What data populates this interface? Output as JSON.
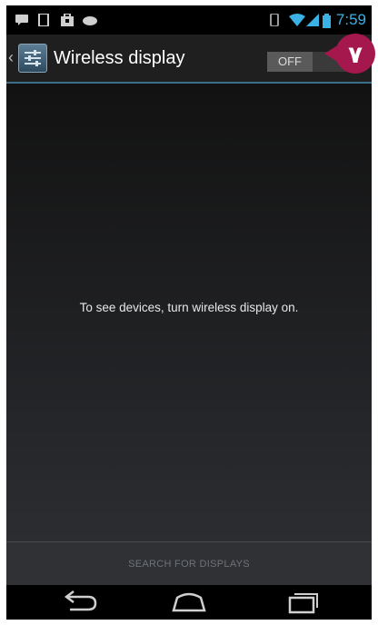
{
  "status_bar": {
    "time": "7:59",
    "notification_icons": [
      "message-icon",
      "sim-icon",
      "bag-icon",
      "controller-icon"
    ],
    "system_icons": [
      "vibrate-icon",
      "wifi-icon",
      "signal-icon",
      "battery-icon"
    ]
  },
  "action_bar": {
    "title": "Wireless display",
    "toggle_label": "OFF",
    "toggle_state": "off",
    "callout_label": "٧"
  },
  "content": {
    "empty_message": "To see devices, turn wireless display on."
  },
  "bottom_action": {
    "label": "SEARCH FOR DISPLAYS",
    "enabled": false
  },
  "nav_bar": {
    "buttons": [
      "back-icon",
      "home-icon",
      "recent-apps-icon"
    ]
  },
  "colors": {
    "accent": "#3bb2e6",
    "callout": "#a5184d"
  }
}
